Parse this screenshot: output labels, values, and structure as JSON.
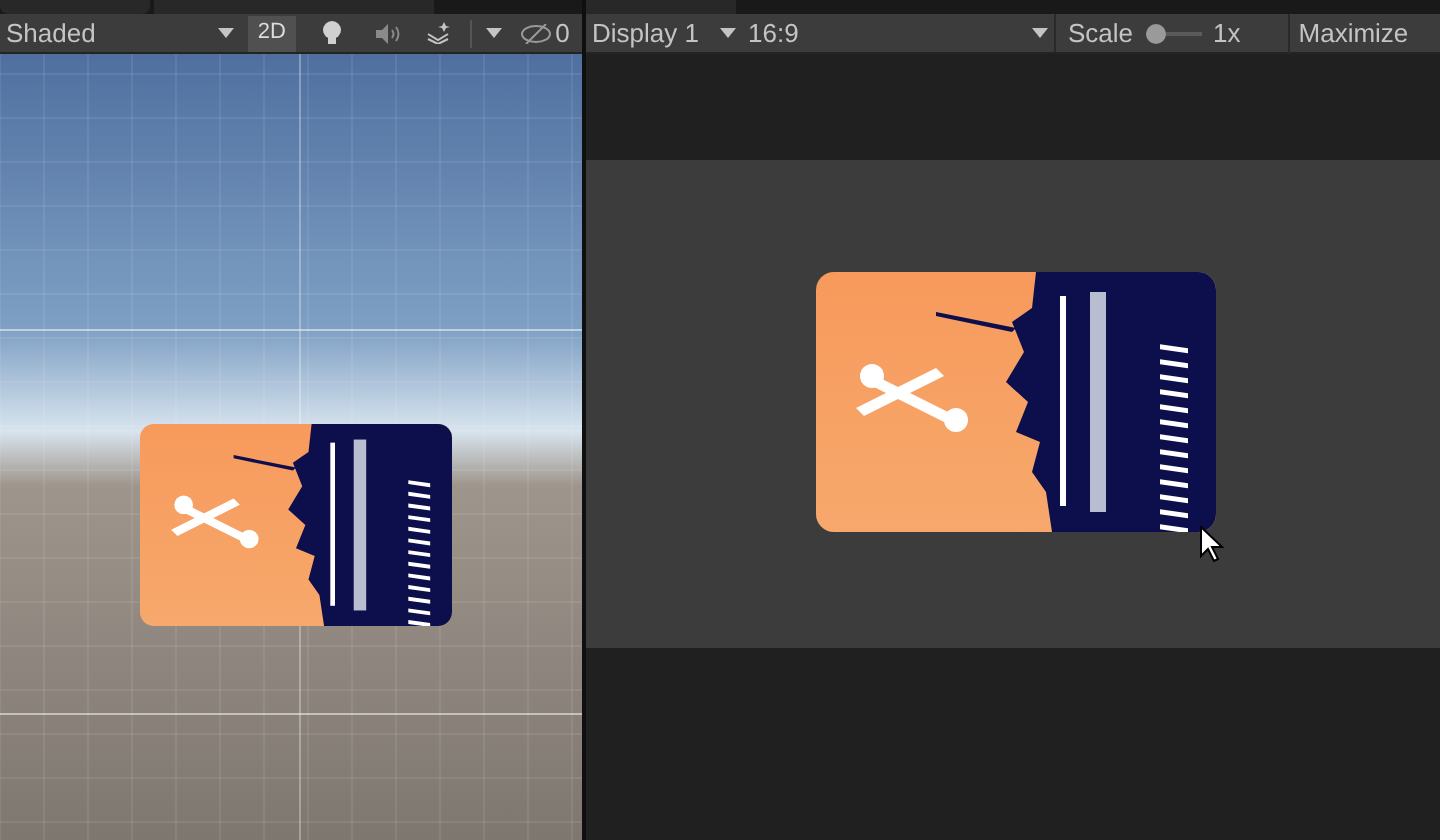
{
  "scene_toolbar": {
    "shading_mode": "Shaded",
    "mode_2d": {
      "label": "2D",
      "on": true
    },
    "hidden_count": "0"
  },
  "game_toolbar": {
    "display": "Display 1",
    "aspect": "16:9",
    "scale": {
      "label": "Scale",
      "level": 0.0,
      "reading": "1x"
    },
    "maximize": "Maximize"
  }
}
